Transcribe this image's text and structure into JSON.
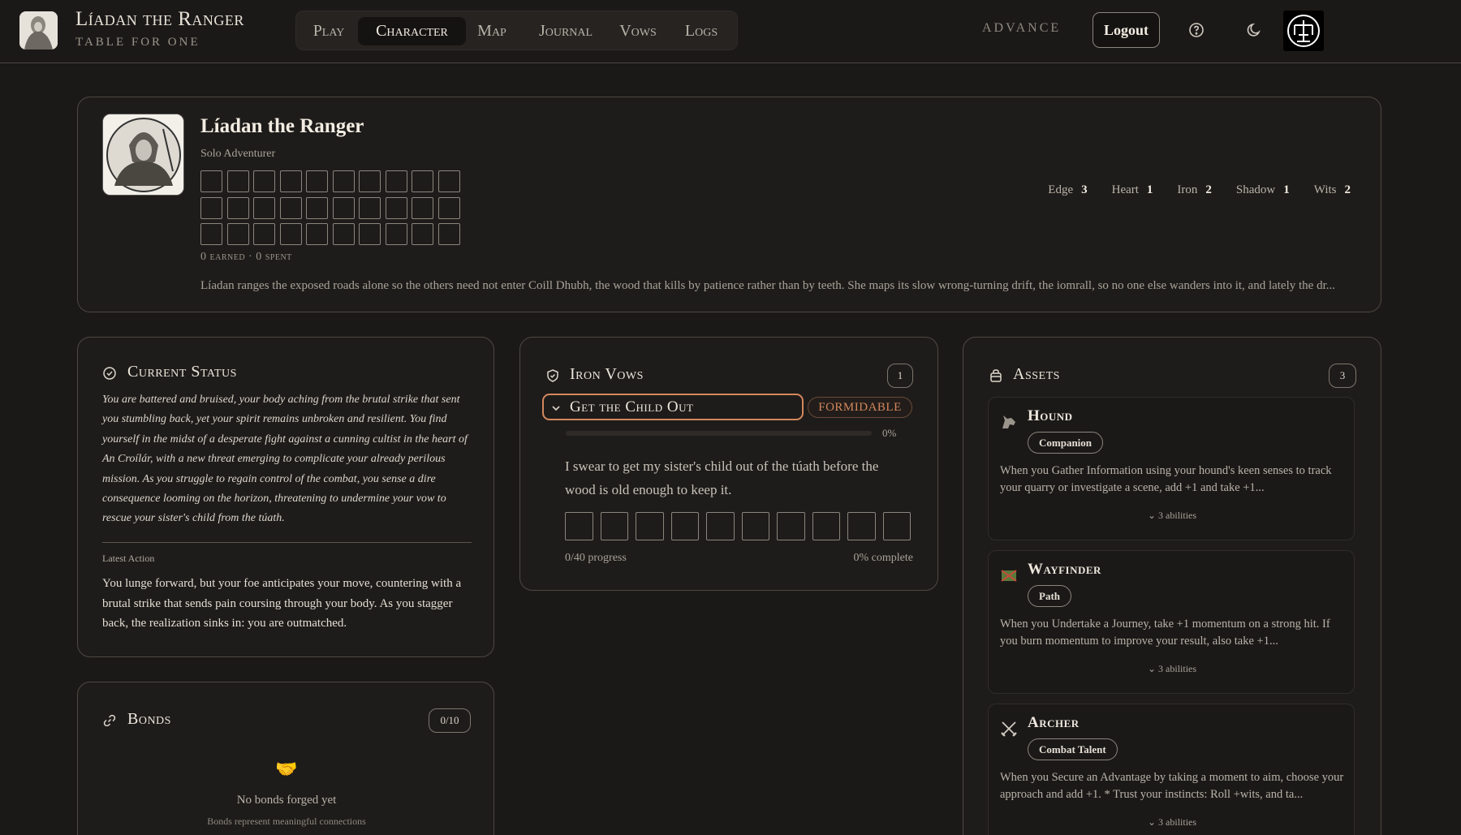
{
  "header": {
    "app_title": "Líadan the Ranger",
    "app_subtitle": "Table for One",
    "nav": [
      {
        "label": "Play",
        "active": false
      },
      {
        "label": "Character",
        "active": true
      },
      {
        "label": "Map",
        "active": false
      },
      {
        "label": "Journal",
        "active": false
      },
      {
        "label": "Vows",
        "active": false
      },
      {
        "label": "Logs",
        "active": false
      }
    ],
    "advance_label": "ADVANCE",
    "logout_label": "Logout",
    "help_icon": "help-circle-icon",
    "theme_icon": "moon-icon"
  },
  "character": {
    "name": "Líadan the Ranger",
    "subtitle": "Solo Adventurer",
    "xp_footer": "0 earned · 0 spent",
    "stats": [
      {
        "label": "Edge",
        "value": "3"
      },
      {
        "label": "Heart",
        "value": "1"
      },
      {
        "label": "Iron",
        "value": "2"
      },
      {
        "label": "Shadow",
        "value": "1"
      },
      {
        "label": "Wits",
        "value": "2"
      }
    ],
    "bio": "Líadan ranges the exposed roads alone so the others need not enter Coill Dhubh, the wood that kills by patience rather than by teeth. She maps its slow wrong-turning drift, the iomrall, so no one else wanders into it, and lately the dr..."
  },
  "status": {
    "title": "Current Status",
    "text": "You are battered and bruised, your body aching from the brutal strike that sent you stumbling back, yet your spirit remains unbroken and resilient. You find yourself in the midst of a desperate fight against a cunning cultist in the heart of An Croílár, with a new threat emerging to complicate your already perilous mission. As you struggle to regain control of the combat, you sense a dire consequence looming on the horizon, threatening to undermine your vow to rescue your sister's child from the túath.",
    "latest_label": "Latest Action",
    "latest_text": "You lunge forward, but your foe anticipates your move, countering with a brutal strike that sends pain coursing through your body. As you stagger back, the realization sinks in: you are outmatched."
  },
  "vows": {
    "title": "Iron Vows",
    "count": "1",
    "items": [
      {
        "title": "Get the Child Out",
        "rank": "FORMIDABLE",
        "percent_label": "0%",
        "progress": 0,
        "description": "I swear to get my sister's child out of the túath before the wood is old enough to keep it.",
        "progress_text": "0/40 progress",
        "complete_text": "0% complete"
      }
    ]
  },
  "assets": {
    "title": "Assets",
    "count": "3",
    "items": [
      {
        "name": "Hound",
        "tag": "Companion",
        "icon": "wolf-icon",
        "desc": "When you Gather Information using your hound's keen senses to track your quarry or investigate a scene, add +1 and take +1...",
        "abilities": "3 abilities"
      },
      {
        "name": "Wayfinder",
        "tag": "Path",
        "icon": "map-icon",
        "desc": "When you Undertake a Journey, take +1 momentum on a strong hit. If you burn momentum to improve your result, also take +1...",
        "abilities": "3 abilities"
      },
      {
        "name": "Archer",
        "tag": "Combat Talent",
        "icon": "crossed-swords-icon",
        "desc": "When you Secure an Advantage by taking a moment to aim, choose your approach and add +1. * Trust your instincts: Roll +wits, and ta...",
        "abilities": "3 abilities"
      }
    ]
  },
  "bonds": {
    "title": "Bonds",
    "count": "0/10",
    "empty_title": "No bonds forged yet",
    "empty_sub": "Bonds represent meaningful connections"
  }
}
